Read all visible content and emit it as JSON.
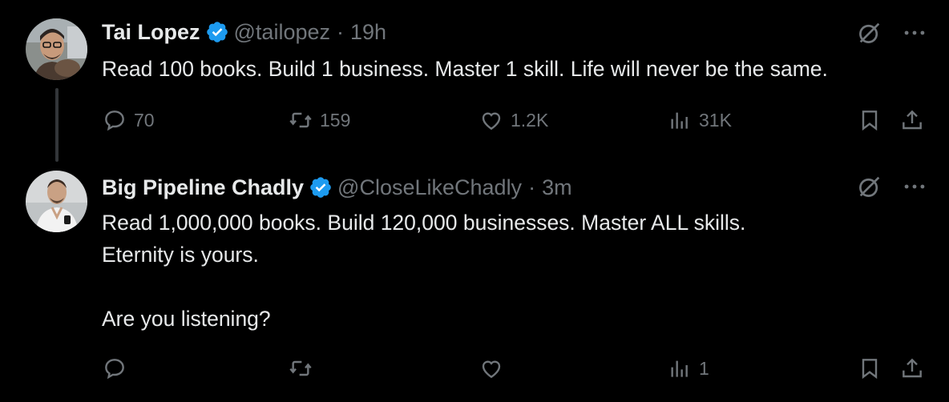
{
  "tweets": [
    {
      "name": "Tai Lopez",
      "handle": "@tailopez",
      "separator": "·",
      "time": "19h",
      "text": "Read 100 books. Build 1 business. Master 1 skill. Life will never be the same.",
      "stats": {
        "replies": "70",
        "reposts": "159",
        "likes": "1.2K",
        "views": "31K"
      }
    },
    {
      "name": "Big Pipeline Chadly",
      "handle": "@CloseLikeChadly",
      "separator": "·",
      "time": "3m",
      "text": "Read 1,000,000 books. Build 120,000 businesses. Master ALL skills.\nEternity is yours.\n\nAre you listening?",
      "stats": {
        "replies": "",
        "reposts": "",
        "likes": "",
        "views": "1"
      }
    }
  ],
  "colors": {
    "background": "#000000",
    "text": "#e7e9ea",
    "muted": "#71767b",
    "verified": "#1d9bf0"
  },
  "icons": [
    "verified-badge-icon",
    "grok-icon",
    "more-icon",
    "reply-icon",
    "repost-icon",
    "like-icon",
    "views-icon",
    "bookmark-icon",
    "share-icon"
  ]
}
